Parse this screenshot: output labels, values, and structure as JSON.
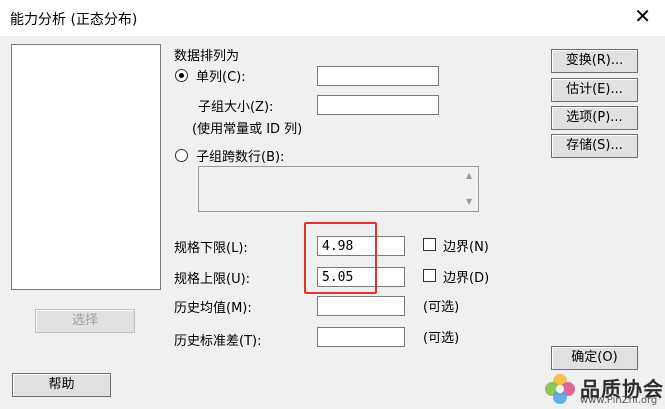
{
  "window": {
    "title": "能力分析 (正态分布)",
    "close_glyph": "✕"
  },
  "section": {
    "title": "数据排列为"
  },
  "single_column": {
    "label": "单列(C):",
    "value": ""
  },
  "subgroup_size": {
    "label": "子组大小(Z):",
    "value": "",
    "note": "(使用常量或 ID 列)"
  },
  "subgroups_across": {
    "label": "子组跨数行(B):"
  },
  "spec_lower": {
    "label": "规格下限(L):",
    "value": "4.98",
    "boundary_label": "边界(N)"
  },
  "spec_upper": {
    "label": "规格上限(U):",
    "value": "5.05",
    "boundary_label": "边界(D)"
  },
  "hist_mean": {
    "label": "历史均值(M):",
    "value": "",
    "optional": "(可选)"
  },
  "hist_std": {
    "label": "历史标准差(T):",
    "value": "",
    "optional": "(可选)"
  },
  "buttons": {
    "transform": "变换(R)...",
    "estimate": "估计(E)...",
    "options": "选项(P)...",
    "storage": "存储(S)...",
    "select": "选择",
    "help": "帮助",
    "ok": "确定(O)"
  },
  "watermark": {
    "text": "品质协会",
    "url": "www.PinZhi.org"
  }
}
